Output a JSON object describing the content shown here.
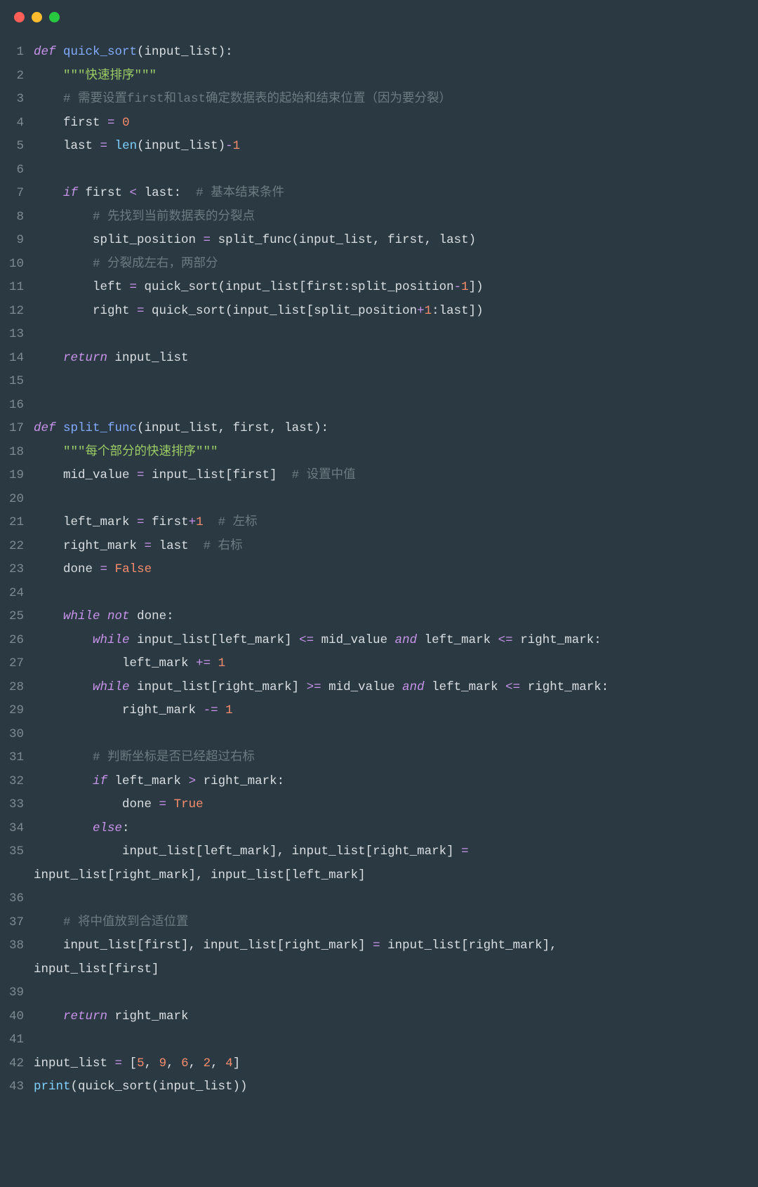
{
  "traffic_lights": [
    "close",
    "minimize",
    "zoom"
  ],
  "code_lines": [
    {
      "n": "1",
      "seg": [
        [
          "kw",
          "def "
        ],
        [
          "fn",
          "quick_sort"
        ],
        [
          "pn",
          "(input_list):"
        ]
      ]
    },
    {
      "n": "2",
      "seg": [
        [
          "pn",
          "    "
        ],
        [
          "str",
          "\"\"\"快速排序\"\"\""
        ]
      ]
    },
    {
      "n": "3",
      "seg": [
        [
          "pn",
          "    "
        ],
        [
          "cm",
          "# 需要设置first和last确定数据表的起始和结束位置（因为要分裂）"
        ]
      ]
    },
    {
      "n": "4",
      "seg": [
        [
          "pn",
          "    first "
        ],
        [
          "op",
          "="
        ],
        [
          "pn",
          " "
        ],
        [
          "num",
          "0"
        ]
      ]
    },
    {
      "n": "5",
      "seg": [
        [
          "pn",
          "    last "
        ],
        [
          "op",
          "="
        ],
        [
          "pn",
          " "
        ],
        [
          "bi",
          "len"
        ],
        [
          "pn",
          "(input_list)"
        ],
        [
          "op",
          "-"
        ],
        [
          "num",
          "1"
        ]
      ]
    },
    {
      "n": "6",
      "seg": [
        [
          "pn",
          ""
        ]
      ]
    },
    {
      "n": "7",
      "seg": [
        [
          "pn",
          "    "
        ],
        [
          "kw",
          "if"
        ],
        [
          "pn",
          " first "
        ],
        [
          "op",
          "<"
        ],
        [
          "pn",
          " last:  "
        ],
        [
          "cm",
          "# 基本结束条件"
        ]
      ]
    },
    {
      "n": "8",
      "seg": [
        [
          "pn",
          "        "
        ],
        [
          "cm",
          "# 先找到当前数据表的分裂点"
        ]
      ]
    },
    {
      "n": "9",
      "seg": [
        [
          "pn",
          "        split_position "
        ],
        [
          "op",
          "="
        ],
        [
          "pn",
          " split_func(input_list, first, last)"
        ]
      ]
    },
    {
      "n": "10",
      "seg": [
        [
          "pn",
          "        "
        ],
        [
          "cm",
          "# 分裂成左右，两部分"
        ]
      ]
    },
    {
      "n": "11",
      "seg": [
        [
          "pn",
          "        left "
        ],
        [
          "op",
          "="
        ],
        [
          "pn",
          " quick_sort(input_list[first:split_position"
        ],
        [
          "op",
          "-"
        ],
        [
          "num",
          "1"
        ],
        [
          "pn",
          "])"
        ]
      ]
    },
    {
      "n": "12",
      "seg": [
        [
          "pn",
          "        right "
        ],
        [
          "op",
          "="
        ],
        [
          "pn",
          " quick_sort(input_list[split_position"
        ],
        [
          "op",
          "+"
        ],
        [
          "num",
          "1"
        ],
        [
          "pn",
          ":last])"
        ]
      ]
    },
    {
      "n": "13",
      "seg": [
        [
          "pn",
          ""
        ]
      ]
    },
    {
      "n": "14",
      "seg": [
        [
          "pn",
          "    "
        ],
        [
          "kw",
          "return"
        ],
        [
          "pn",
          " input_list"
        ]
      ]
    },
    {
      "n": "15",
      "seg": [
        [
          "pn",
          ""
        ]
      ]
    },
    {
      "n": "16",
      "seg": [
        [
          "pn",
          ""
        ]
      ]
    },
    {
      "n": "17",
      "seg": [
        [
          "kw",
          "def "
        ],
        [
          "fn",
          "split_func"
        ],
        [
          "pn",
          "(input_list, first, last):"
        ]
      ]
    },
    {
      "n": "18",
      "seg": [
        [
          "pn",
          "    "
        ],
        [
          "str",
          "\"\"\"每个部分的快速排序\"\"\""
        ]
      ]
    },
    {
      "n": "19",
      "seg": [
        [
          "pn",
          "    mid_value "
        ],
        [
          "op",
          "="
        ],
        [
          "pn",
          " input_list[first]  "
        ],
        [
          "cm",
          "# 设置中值"
        ]
      ]
    },
    {
      "n": "20",
      "seg": [
        [
          "pn",
          ""
        ]
      ]
    },
    {
      "n": "21",
      "seg": [
        [
          "pn",
          "    left_mark "
        ],
        [
          "op",
          "="
        ],
        [
          "pn",
          " first"
        ],
        [
          "op",
          "+"
        ],
        [
          "num",
          "1"
        ],
        [
          "pn",
          "  "
        ],
        [
          "cm",
          "# 左标"
        ]
      ]
    },
    {
      "n": "22",
      "seg": [
        [
          "pn",
          "    right_mark "
        ],
        [
          "op",
          "="
        ],
        [
          "pn",
          " last  "
        ],
        [
          "cm",
          "# 右标"
        ]
      ]
    },
    {
      "n": "23",
      "seg": [
        [
          "pn",
          "    done "
        ],
        [
          "op",
          "="
        ],
        [
          "pn",
          " "
        ],
        [
          "bool",
          "False"
        ]
      ]
    },
    {
      "n": "24",
      "seg": [
        [
          "pn",
          ""
        ]
      ]
    },
    {
      "n": "25",
      "seg": [
        [
          "pn",
          "    "
        ],
        [
          "kw",
          "while"
        ],
        [
          "pn",
          " "
        ],
        [
          "kw",
          "not"
        ],
        [
          "pn",
          " done:"
        ]
      ]
    },
    {
      "n": "26",
      "seg": [
        [
          "pn",
          "        "
        ],
        [
          "kw",
          "while"
        ],
        [
          "pn",
          " input_list[left_mark] "
        ],
        [
          "op",
          "<="
        ],
        [
          "pn",
          " mid_value "
        ],
        [
          "kw",
          "and"
        ],
        [
          "pn",
          " left_mark "
        ],
        [
          "op",
          "<="
        ],
        [
          "pn",
          " right_mark:"
        ]
      ]
    },
    {
      "n": "27",
      "seg": [
        [
          "pn",
          "            left_mark "
        ],
        [
          "op",
          "+="
        ],
        [
          "pn",
          " "
        ],
        [
          "num",
          "1"
        ]
      ]
    },
    {
      "n": "28",
      "seg": [
        [
          "pn",
          "        "
        ],
        [
          "kw",
          "while"
        ],
        [
          "pn",
          " input_list[right_mark] "
        ],
        [
          "op",
          ">="
        ],
        [
          "pn",
          " mid_value "
        ],
        [
          "kw",
          "and"
        ],
        [
          "pn",
          " left_mark "
        ],
        [
          "op",
          "<="
        ],
        [
          "pn",
          " right_mark:"
        ]
      ]
    },
    {
      "n": "29",
      "seg": [
        [
          "pn",
          "            right_mark "
        ],
        [
          "op",
          "-="
        ],
        [
          "pn",
          " "
        ],
        [
          "num",
          "1"
        ]
      ]
    },
    {
      "n": "30",
      "seg": [
        [
          "pn",
          ""
        ]
      ]
    },
    {
      "n": "31",
      "seg": [
        [
          "pn",
          "        "
        ],
        [
          "cm",
          "# 判断坐标是否已经超过右标"
        ]
      ]
    },
    {
      "n": "32",
      "seg": [
        [
          "pn",
          "        "
        ],
        [
          "kw",
          "if"
        ],
        [
          "pn",
          " left_mark "
        ],
        [
          "op",
          ">"
        ],
        [
          "pn",
          " right_mark:"
        ]
      ]
    },
    {
      "n": "33",
      "seg": [
        [
          "pn",
          "            done "
        ],
        [
          "op",
          "="
        ],
        [
          "pn",
          " "
        ],
        [
          "bool",
          "True"
        ]
      ]
    },
    {
      "n": "34",
      "seg": [
        [
          "pn",
          "        "
        ],
        [
          "kw",
          "else"
        ],
        [
          "pn",
          ":"
        ]
      ]
    },
    {
      "n": "35",
      "seg": [
        [
          "pn",
          "            input_list[left_mark], input_list[right_mark] "
        ],
        [
          "op",
          "="
        ],
        [
          "pn",
          " "
        ]
      ]
    },
    {
      "n": "",
      "cont": true,
      "seg": [
        [
          "pn",
          "input_list[right_mark], input_list[left_mark]"
        ]
      ]
    },
    {
      "n": "36",
      "seg": [
        [
          "pn",
          ""
        ]
      ]
    },
    {
      "n": "37",
      "seg": [
        [
          "pn",
          "    "
        ],
        [
          "cm",
          "# 将中值放到合适位置"
        ]
      ]
    },
    {
      "n": "38",
      "seg": [
        [
          "pn",
          "    input_list[first], input_list[right_mark] "
        ],
        [
          "op",
          "="
        ],
        [
          "pn",
          " input_list[right_mark], "
        ]
      ]
    },
    {
      "n": "",
      "cont": true,
      "seg": [
        [
          "pn",
          "input_list[first]"
        ]
      ]
    },
    {
      "n": "39",
      "seg": [
        [
          "pn",
          ""
        ]
      ]
    },
    {
      "n": "40",
      "seg": [
        [
          "pn",
          "    "
        ],
        [
          "kw",
          "return"
        ],
        [
          "pn",
          " right_mark"
        ]
      ]
    },
    {
      "n": "41",
      "seg": [
        [
          "pn",
          ""
        ]
      ]
    },
    {
      "n": "42",
      "seg": [
        [
          "pn",
          "input_list "
        ],
        [
          "op",
          "="
        ],
        [
          "pn",
          " ["
        ],
        [
          "num",
          "5"
        ],
        [
          "pn",
          ", "
        ],
        [
          "num",
          "9"
        ],
        [
          "pn",
          ", "
        ],
        [
          "num",
          "6"
        ],
        [
          "pn",
          ", "
        ],
        [
          "num",
          "2"
        ],
        [
          "pn",
          ", "
        ],
        [
          "num",
          "4"
        ],
        [
          "pn",
          "]"
        ]
      ]
    },
    {
      "n": "43",
      "seg": [
        [
          "bi",
          "print"
        ],
        [
          "pn",
          "(quick_sort(input_list))"
        ]
      ]
    }
  ]
}
